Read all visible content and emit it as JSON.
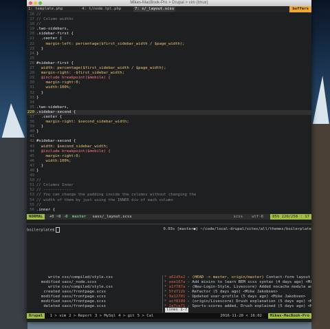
{
  "window": {
    "title": "Mikes-MacBook-Pro > Drupal > vim (tmux)"
  },
  "tabs": [
    {
      "label": "1: template.php"
    },
    {
      "label": "4: t/node.tpl.php"
    },
    {
      "label": "7: s/_layout.scss"
    }
  ],
  "buffers_label": "buffers",
  "editor": {
    "lines": [
      {
        "n": "16",
        "t": "//",
        "c": "com"
      },
      {
        "n": "17",
        "t": "// Column widths",
        "c": "com"
      },
      {
        "n": "18",
        "t": "//",
        "c": "com"
      },
      {
        "n": "19",
        "t": ".two-sidebars,",
        "c": "sel"
      },
      {
        "n": "20",
        "t": ".sidebar-first {",
        "c": "sel"
      },
      {
        "n": "21",
        "t": "  .center {",
        "c": "sel"
      },
      {
        "n": "22",
        "t": "    margin-left: percentage($first_sidebar_width / $page_width);",
        "c": "prop"
      },
      {
        "n": "23",
        "t": "  }",
        "c": "sel"
      },
      {
        "n": "24",
        "t": "}",
        "c": "sel"
      },
      {
        "n": "25",
        "t": "",
        "c": "sel"
      },
      {
        "n": "26",
        "t": "#sidebar-first {",
        "c": "sel"
      },
      {
        "n": "27",
        "t": "  width: percentage($first_sidebar_width / $page_width);",
        "c": "prop"
      },
      {
        "n": "28",
        "t": "  margin-right: -$first_sidebar_width;",
        "c": "prop"
      },
      {
        "n": "29",
        "t": "  @include breakpoint($mobile) {",
        "c": "kw"
      },
      {
        "n": "30",
        "t": "    margin-right:0;",
        "c": "prop"
      },
      {
        "n": "31",
        "t": "    width:100%;",
        "c": "prop"
      },
      {
        "n": "32",
        "t": "  }",
        "c": "sel"
      },
      {
        "n": "33",
        "t": "}",
        "c": "sel"
      },
      {
        "n": "34",
        "t": "",
        "c": "sel"
      },
      {
        "n": "35",
        "t": ".two-sidebars,",
        "c": "sel"
      },
      {
        "n": "220",
        "t": ".sidebar-second {",
        "c": "sel",
        "cur": true
      },
      {
        "n": "37",
        "t": "  .center {",
        "c": "sel"
      },
      {
        "n": "38",
        "t": "    margin-right: $second_sidebar_width;",
        "c": "prop"
      },
      {
        "n": "39",
        "t": "  }",
        "c": "sel"
      },
      {
        "n": "40",
        "t": "}",
        "c": "sel"
      },
      {
        "n": "41",
        "t": "",
        "c": "sel"
      },
      {
        "n": "42",
        "t": "#sidebar-second {",
        "c": "sel"
      },
      {
        "n": "43",
        "t": "  width: $second_sidebar_width;",
        "c": "prop"
      },
      {
        "n": "44",
        "t": "  @include breakpoint($mobile) {",
        "c": "kw"
      },
      {
        "n": "45",
        "t": "    margin-right:0;",
        "c": "prop"
      },
      {
        "n": "46",
        "t": "    width:100%;",
        "c": "prop"
      },
      {
        "n": "47",
        "t": "  }",
        "c": "sel"
      },
      {
        "n": "48",
        "t": "}",
        "c": "sel"
      },
      {
        "n": "49",
        "t": "",
        "c": "sel"
      },
      {
        "n": "50",
        "t": "//",
        "c": "com"
      },
      {
        "n": "51",
        "t": "// Columns Inner",
        "c": "com"
      },
      {
        "n": "52",
        "t": "// -------------",
        "c": "com"
      },
      {
        "n": "53",
        "t": "// You can change the padding inside the columns without changing the",
        "c": "com"
      },
      {
        "n": "54",
        "t": "// width of them by just using the INNER div of each column",
        "c": "com"
      },
      {
        "n": "55",
        "t": "//",
        "c": "com"
      },
      {
        "n": "56",
        "t": ".inner {",
        "c": "sel"
      }
    ]
  },
  "statusline": {
    "mode": "NORMAL",
    "git": "+0 ~0 -0",
    "branch": "master",
    "file": "sass/_layout.scss",
    "filetype": "scss",
    "encoding": "utf-8",
    "position": "85% 220/258 : 17"
  },
  "terminal": {
    "prompt": "boilerplate$",
    "timing": "0.03s",
    "path": "[master●] ~/code/local-drupal/sites/all/themes/boilerplate"
  },
  "git_status": [
    {
      "k": "write",
      "v": "css/compiled/style.css"
    },
    {
      "k": "modified",
      "v": "sass/_node.scss"
    },
    {
      "k": "write",
      "v": "css/compiled/style.css"
    },
    {
      "k": "created",
      "v": "sass/frontpage.scss"
    },
    {
      "k": "modified",
      "v": "sass/frontpage.scss"
    },
    {
      "k": "modified",
      "v": "sass/frontpage.scss"
    },
    {
      "k": "deleted",
      "v": "sass/frontpage.scss"
    }
  ],
  "git_log": [
    {
      "hash": "* a62d5e2",
      "ref": "(HEAD -> master, origin/master)",
      "msg": "Contact-form layout u"
    },
    {
      "hash": "* eee167a",
      "ref": "",
      "msg": "Add mixins to learn BEM scss syntax (4 days ago) <Mik"
    },
    {
      "hash": "* a1f787a",
      "ref": "",
      "msg": "(New-Login-Style, Livescore) Added nocache module and"
    },
    {
      "hash": "* 5fd712b",
      "ref": "",
      "msg": "Refactor (5 days ago) <Mike Jakobsen>"
    },
    {
      "hash": "* 9a12701",
      "ref": "",
      "msg": "Updated user-profile (5 days ago) <Mike Jakobsen>"
    },
    {
      "hash": "* acf8109",
      "ref": "",
      "msg": "(origin/Livescore) Drush explanation (5 days ago) <Mi"
    },
    {
      "hash": "* 2a7ce71",
      "ref": "",
      "msg": "Sports-scores added, Drush explained (5 days ago) <Mi"
    }
  ],
  "lines_badge": "lines 1-7",
  "tmux": {
    "session": "Drupal",
    "windows": [
      "1 > vim",
      "2 > Report",
      "3 > MySql",
      "4 > git",
      "5 > Cal"
    ],
    "date": "2016-11-20 < 16:02",
    "host": "Mikes-MacBook-Pro"
  },
  "colors": {
    "accent": "#a0c040",
    "buffers": "#f0a830"
  }
}
